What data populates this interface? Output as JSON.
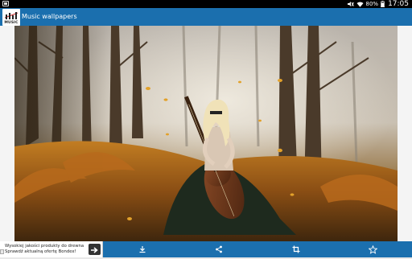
{
  "status_bar": {
    "battery_percent": "80%",
    "time": "17:05",
    "icons": [
      "notification-icon",
      "mute-icon",
      "wifi-icon",
      "battery-icon"
    ]
  },
  "app": {
    "title": "Music wallpapers",
    "icon_label": "MUSIC",
    "accent_color": "#1b6fae"
  },
  "wallpaper": {
    "subject": "woman-with-cello-in-forest"
  },
  "ad": {
    "line1": "Wysokiej jakości produkty do drewna",
    "line2": "Sprawdź aktualną ofertę Bondex!"
  },
  "bottom_bar": {
    "buttons": [
      "download-icon",
      "share-icon",
      "crop-icon",
      "star-icon"
    ]
  }
}
